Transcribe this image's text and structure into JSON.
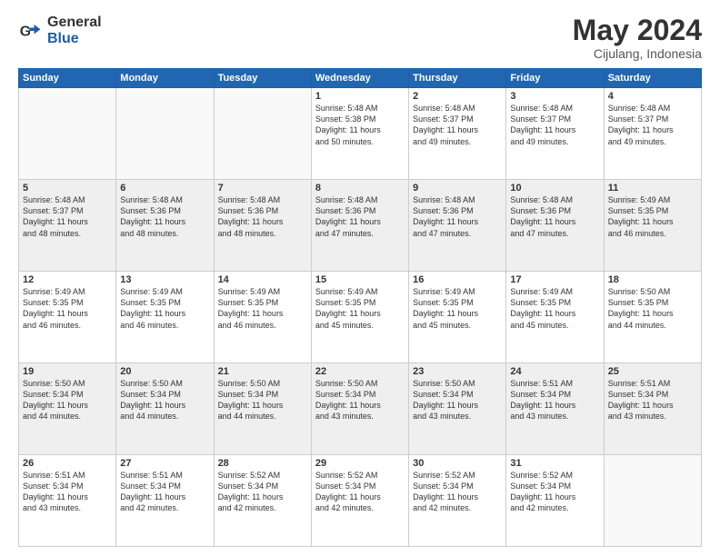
{
  "header": {
    "logo_general": "General",
    "logo_blue": "Blue",
    "title": "May 2024",
    "location": "Cijulang, Indonesia"
  },
  "weekdays": [
    "Sunday",
    "Monday",
    "Tuesday",
    "Wednesday",
    "Thursday",
    "Friday",
    "Saturday"
  ],
  "weeks": [
    [
      {
        "day": "",
        "info": ""
      },
      {
        "day": "",
        "info": ""
      },
      {
        "day": "",
        "info": ""
      },
      {
        "day": "1",
        "info": "Sunrise: 5:48 AM\nSunset: 5:38 PM\nDaylight: 11 hours\nand 50 minutes."
      },
      {
        "day": "2",
        "info": "Sunrise: 5:48 AM\nSunset: 5:37 PM\nDaylight: 11 hours\nand 49 minutes."
      },
      {
        "day": "3",
        "info": "Sunrise: 5:48 AM\nSunset: 5:37 PM\nDaylight: 11 hours\nand 49 minutes."
      },
      {
        "day": "4",
        "info": "Sunrise: 5:48 AM\nSunset: 5:37 PM\nDaylight: 11 hours\nand 49 minutes."
      }
    ],
    [
      {
        "day": "5",
        "info": "Sunrise: 5:48 AM\nSunset: 5:37 PM\nDaylight: 11 hours\nand 48 minutes."
      },
      {
        "day": "6",
        "info": "Sunrise: 5:48 AM\nSunset: 5:36 PM\nDaylight: 11 hours\nand 48 minutes."
      },
      {
        "day": "7",
        "info": "Sunrise: 5:48 AM\nSunset: 5:36 PM\nDaylight: 11 hours\nand 48 minutes."
      },
      {
        "day": "8",
        "info": "Sunrise: 5:48 AM\nSunset: 5:36 PM\nDaylight: 11 hours\nand 47 minutes."
      },
      {
        "day": "9",
        "info": "Sunrise: 5:48 AM\nSunset: 5:36 PM\nDaylight: 11 hours\nand 47 minutes."
      },
      {
        "day": "10",
        "info": "Sunrise: 5:48 AM\nSunset: 5:36 PM\nDaylight: 11 hours\nand 47 minutes."
      },
      {
        "day": "11",
        "info": "Sunrise: 5:49 AM\nSunset: 5:35 PM\nDaylight: 11 hours\nand 46 minutes."
      }
    ],
    [
      {
        "day": "12",
        "info": "Sunrise: 5:49 AM\nSunset: 5:35 PM\nDaylight: 11 hours\nand 46 minutes."
      },
      {
        "day": "13",
        "info": "Sunrise: 5:49 AM\nSunset: 5:35 PM\nDaylight: 11 hours\nand 46 minutes."
      },
      {
        "day": "14",
        "info": "Sunrise: 5:49 AM\nSunset: 5:35 PM\nDaylight: 11 hours\nand 46 minutes."
      },
      {
        "day": "15",
        "info": "Sunrise: 5:49 AM\nSunset: 5:35 PM\nDaylight: 11 hours\nand 45 minutes."
      },
      {
        "day": "16",
        "info": "Sunrise: 5:49 AM\nSunset: 5:35 PM\nDaylight: 11 hours\nand 45 minutes."
      },
      {
        "day": "17",
        "info": "Sunrise: 5:49 AM\nSunset: 5:35 PM\nDaylight: 11 hours\nand 45 minutes."
      },
      {
        "day": "18",
        "info": "Sunrise: 5:50 AM\nSunset: 5:35 PM\nDaylight: 11 hours\nand 44 minutes."
      }
    ],
    [
      {
        "day": "19",
        "info": "Sunrise: 5:50 AM\nSunset: 5:34 PM\nDaylight: 11 hours\nand 44 minutes."
      },
      {
        "day": "20",
        "info": "Sunrise: 5:50 AM\nSunset: 5:34 PM\nDaylight: 11 hours\nand 44 minutes."
      },
      {
        "day": "21",
        "info": "Sunrise: 5:50 AM\nSunset: 5:34 PM\nDaylight: 11 hours\nand 44 minutes."
      },
      {
        "day": "22",
        "info": "Sunrise: 5:50 AM\nSunset: 5:34 PM\nDaylight: 11 hours\nand 43 minutes."
      },
      {
        "day": "23",
        "info": "Sunrise: 5:50 AM\nSunset: 5:34 PM\nDaylight: 11 hours\nand 43 minutes."
      },
      {
        "day": "24",
        "info": "Sunrise: 5:51 AM\nSunset: 5:34 PM\nDaylight: 11 hours\nand 43 minutes."
      },
      {
        "day": "25",
        "info": "Sunrise: 5:51 AM\nSunset: 5:34 PM\nDaylight: 11 hours\nand 43 minutes."
      }
    ],
    [
      {
        "day": "26",
        "info": "Sunrise: 5:51 AM\nSunset: 5:34 PM\nDaylight: 11 hours\nand 43 minutes."
      },
      {
        "day": "27",
        "info": "Sunrise: 5:51 AM\nSunset: 5:34 PM\nDaylight: 11 hours\nand 42 minutes."
      },
      {
        "day": "28",
        "info": "Sunrise: 5:52 AM\nSunset: 5:34 PM\nDaylight: 11 hours\nand 42 minutes."
      },
      {
        "day": "29",
        "info": "Sunrise: 5:52 AM\nSunset: 5:34 PM\nDaylight: 11 hours\nand 42 minutes."
      },
      {
        "day": "30",
        "info": "Sunrise: 5:52 AM\nSunset: 5:34 PM\nDaylight: 11 hours\nand 42 minutes."
      },
      {
        "day": "31",
        "info": "Sunrise: 5:52 AM\nSunset: 5:34 PM\nDaylight: 11 hours\nand 42 minutes."
      },
      {
        "day": "",
        "info": ""
      }
    ]
  ]
}
